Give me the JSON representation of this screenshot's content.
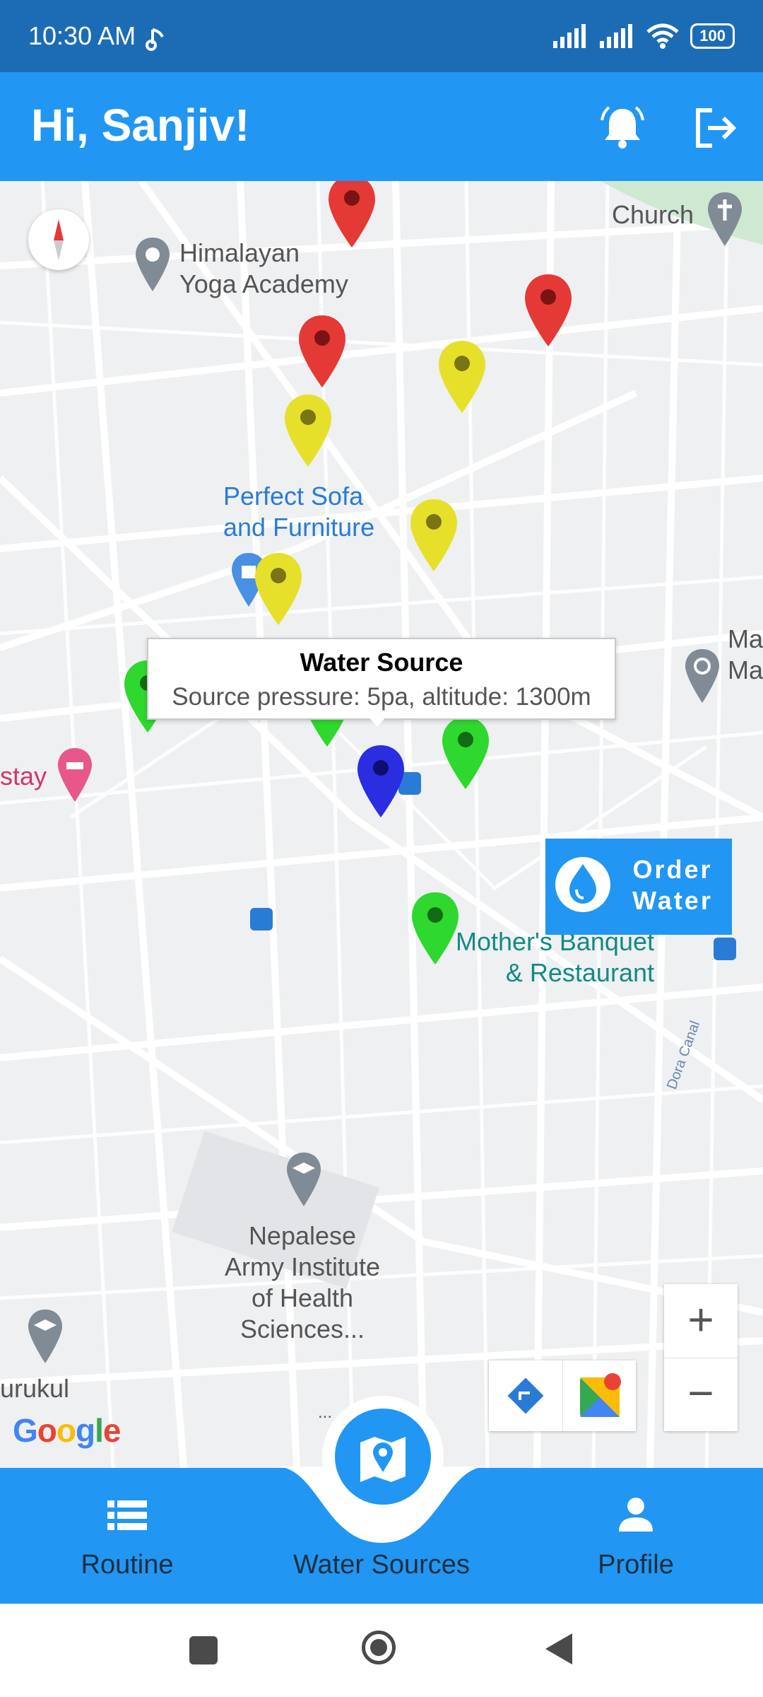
{
  "status_bar": {
    "time": "10:30 AM",
    "battery": "100"
  },
  "header": {
    "greeting": "Hi, Sanjiv!"
  },
  "map": {
    "places": {
      "church": "Church",
      "yoga_line1": "Himalayan",
      "yoga_line2": "Yoga Academy",
      "sofa_line1": "Perfect Sofa",
      "sofa_line2": "and Furniture",
      "ma_line1": "Ma",
      "ma_line2": "Ma",
      "stay": "stay",
      "banquet_line1": "Mother's Banquet",
      "banquet_line2": "& Restaurant",
      "canal": "Dora Canal",
      "army_line1": "Nepalese",
      "army_line2": "Army Institute",
      "army_line3": "of Health",
      "army_line4": "Sciences...",
      "gurukul": "urukul",
      "ellipsis": "..."
    },
    "info_window": {
      "title": "Water Source",
      "subtitle": "Source pressure: 5pa, altitude: 1300m"
    },
    "order_button": {
      "line1": "Order",
      "line2": "Water"
    },
    "google_logo": "Google",
    "zoom_in": "+",
    "zoom_out": "−",
    "colors": {
      "red": "#e53935",
      "yellow": "#e6e02b",
      "green": "#2ed82e",
      "blue": "#2a2ee0"
    }
  },
  "bottom_nav": {
    "items": [
      {
        "label": "Routine",
        "icon": "list-icon"
      },
      {
        "label": "Water Sources",
        "icon": "map-icon"
      },
      {
        "label": "Profile",
        "icon": "person-icon"
      }
    ]
  }
}
